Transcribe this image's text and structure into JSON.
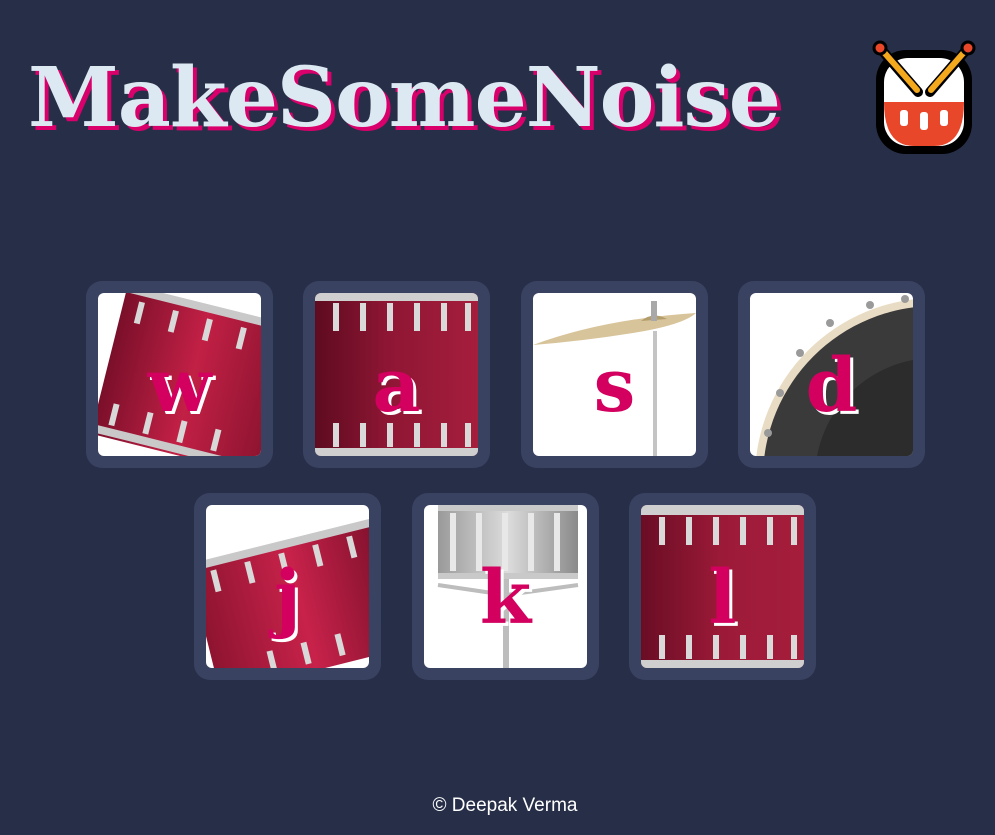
{
  "header": {
    "title": "MakeSomeNoise",
    "icon": "drum-emoji-icon"
  },
  "pads": [
    {
      "key": "w",
      "instrument": "tom-1",
      "icon": "tilted-red-drum-icon"
    },
    {
      "key": "a",
      "instrument": "tom-2",
      "icon": "red-drum-icon"
    },
    {
      "key": "s",
      "instrument": "crash-cymbal",
      "icon": "cymbal-icon"
    },
    {
      "key": "d",
      "instrument": "kick-bass",
      "icon": "bass-drum-icon"
    },
    {
      "key": "j",
      "instrument": "snare",
      "icon": "tilted-red-drum-icon"
    },
    {
      "key": "k",
      "instrument": "tom-3",
      "icon": "silver-drum-icon"
    },
    {
      "key": "l",
      "instrument": "tom-4",
      "icon": "red-drum-icon"
    }
  ],
  "footer": {
    "text": "© Deepak Verma"
  },
  "colors": {
    "background": "#272e48",
    "pad_border": "#3a4262",
    "accent": "#d3005f",
    "title": "#dce9f2"
  }
}
